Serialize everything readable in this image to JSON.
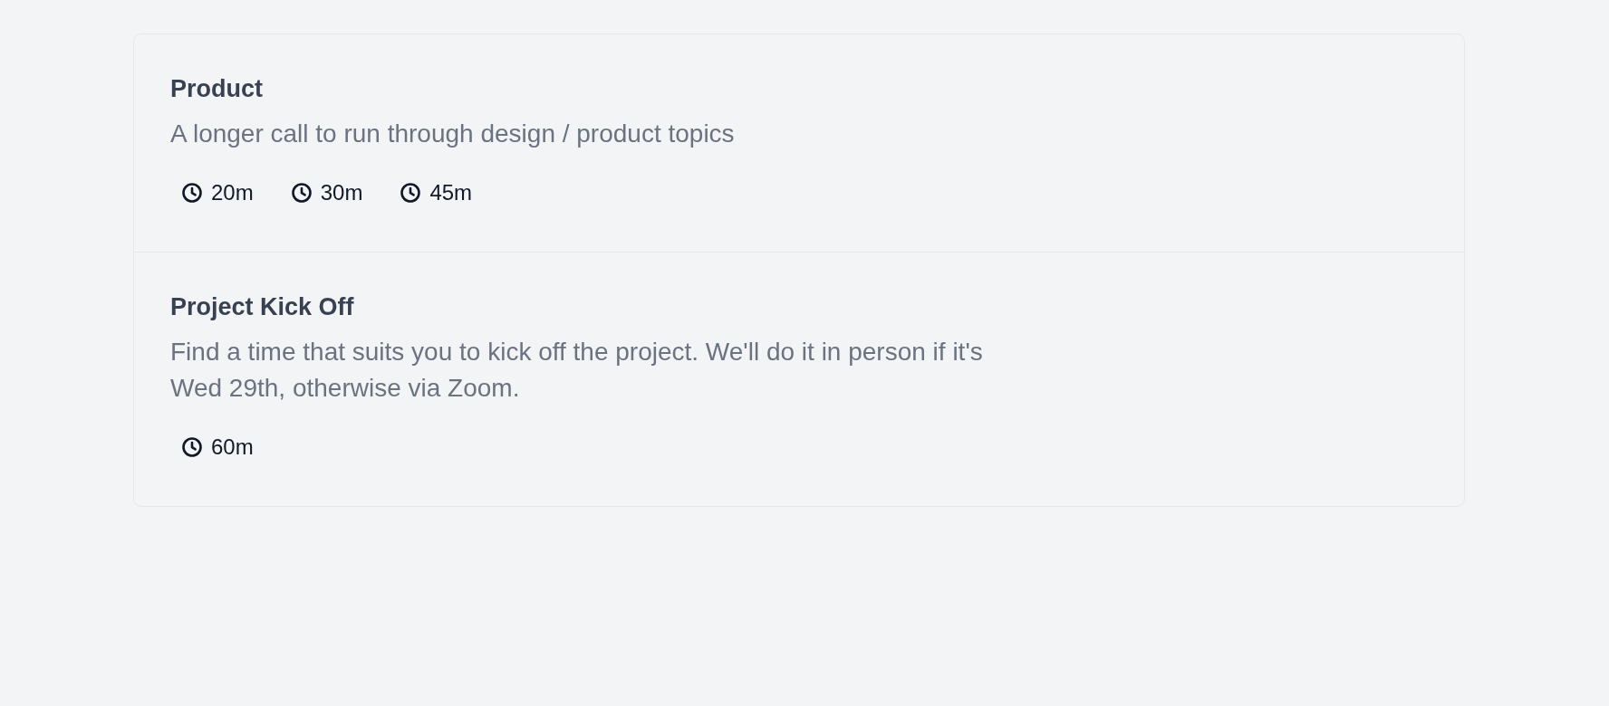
{
  "event_types": [
    {
      "title": "Product",
      "description": "A longer call to run through design / product topics",
      "durations": [
        "20m",
        "30m",
        "45m"
      ]
    },
    {
      "title": "Project Kick Off",
      "description": "Find a time that suits you to kick off the project. We'll do it in person if it's Wed 29th, otherwise via Zoom.",
      "durations": [
        "60m"
      ]
    }
  ]
}
